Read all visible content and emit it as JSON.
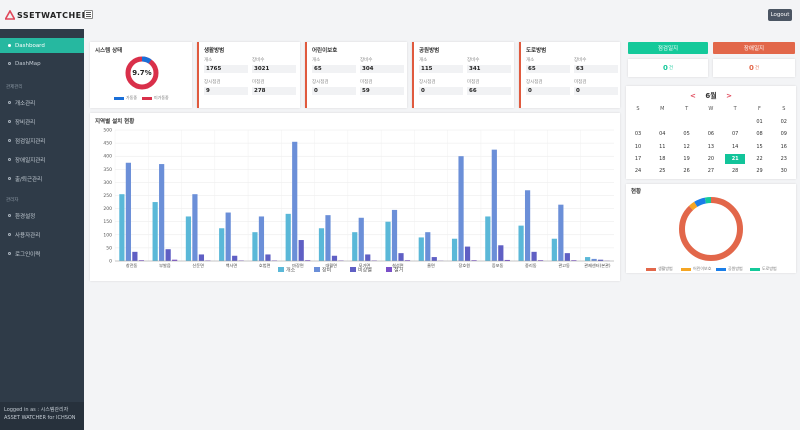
{
  "app": {
    "logo_text": "SSETWATCHER",
    "logout_label": "Logout"
  },
  "sidebar": {
    "items_top": [
      {
        "label": "Dashboard",
        "active": true
      },
      {
        "label": "DashMap",
        "active": false
      }
    ],
    "section_admin": "관제관리",
    "items_admin": [
      {
        "label": "개소관리"
      },
      {
        "label": "장비관리"
      },
      {
        "label": "점검일지관리"
      },
      {
        "label": "장애일지관리"
      },
      {
        "label": "출/퇴근관리"
      }
    ],
    "section_system": "관리자",
    "items_system": [
      {
        "label": "환경설정"
      },
      {
        "label": "사용자관리"
      },
      {
        "label": "로그인이력"
      }
    ],
    "footer_user": "Logged in as : 시스템관리자",
    "footer_product": "ASSET WATCHER for ICHSON"
  },
  "system_status": {
    "title": "시스템 상태",
    "percent_label": "9.7%",
    "percent_value": 9.7,
    "legend": [
      {
        "label": "가동중",
        "color": "#1a6fd8"
      },
      {
        "label": "미가동중",
        "color": "#d9304a"
      }
    ]
  },
  "stat_cards": [
    {
      "title": "생활방범",
      "values": [
        {
          "label": "개소",
          "value": "1765"
        },
        {
          "label": "장비수",
          "value": "3021"
        },
        {
          "label": "장시점검",
          "value": "9"
        },
        {
          "label": "미점검",
          "value": "278"
        }
      ]
    },
    {
      "title": "어린이보호",
      "values": [
        {
          "label": "개소",
          "value": "65"
        },
        {
          "label": "장비수",
          "value": "304"
        },
        {
          "label": "장시점검",
          "value": "0"
        },
        {
          "label": "미점검",
          "value": "59"
        }
      ]
    },
    {
      "title": "공원방범",
      "values": [
        {
          "label": "개소",
          "value": "115"
        },
        {
          "label": "장비수",
          "value": "341"
        },
        {
          "label": "장시점검",
          "value": "0"
        },
        {
          "label": "미점검",
          "value": "66"
        }
      ]
    },
    {
      "title": "도로방범",
      "values": [
        {
          "label": "개소",
          "value": "65"
        },
        {
          "label": "장비수",
          "value": "63"
        },
        {
          "label": "장시점검",
          "value": "0"
        },
        {
          "label": "미점검",
          "value": "0"
        }
      ]
    }
  ],
  "chart": {
    "title": "지역별 설치 현황"
  },
  "chart_data": {
    "type": "bar",
    "title": "지역별 설치 현황",
    "categories": [
      "창전동",
      "부발읍",
      "신둔면",
      "백사면",
      "호법면",
      "마장면",
      "대월면",
      "모가면",
      "설성면",
      "율면",
      "장호원",
      "증포동",
      "중리동",
      "관고동",
      "관제센터(본관)"
    ],
    "ylim": [
      0,
      500
    ],
    "yticks": [
      0,
      50,
      100,
      150,
      200,
      250,
      300,
      350,
      400,
      450,
      500
    ],
    "grid": true,
    "legend_position": "bottom",
    "series": [
      {
        "name": "개소",
        "color": "#5ab8d8",
        "values": [
          255,
          225,
          170,
          125,
          110,
          180,
          125,
          110,
          150,
          90,
          85,
          170,
          135,
          85,
          15
        ]
      },
      {
        "name": "장비",
        "color": "#6b8fd8",
        "values": [
          375,
          370,
          255,
          185,
          170,
          455,
          175,
          165,
          195,
          110,
          400,
          425,
          270,
          215,
          8
        ]
      },
      {
        "name": "비상벨",
        "color": "#5f5fc4",
        "values": [
          35,
          45,
          25,
          20,
          25,
          80,
          20,
          25,
          30,
          15,
          55,
          60,
          35,
          30,
          5
        ]
      },
      {
        "name": "철거",
        "color": "#7a4fc8",
        "values": [
          3,
          5,
          2,
          2,
          2,
          3,
          2,
          2,
          3,
          1,
          3,
          4,
          3,
          3,
          1
        ]
      }
    ]
  },
  "right": {
    "inspection_button": "점검일지",
    "inspection_color": "#14c99a",
    "inspection_count": "0",
    "fault_button": "장애일지",
    "fault_color": "#e2674a",
    "fault_count": "0",
    "count_unit": "건"
  },
  "calendar": {
    "prev": "<",
    "next": ">",
    "month_label": "6월",
    "days_of_week": [
      "S",
      "M",
      "T",
      "W",
      "T",
      "F",
      "S"
    ],
    "weeks": [
      [
        "",
        "",
        "",
        "",
        "",
        "01",
        "02"
      ],
      [
        "03",
        "04",
        "05",
        "06",
        "07",
        "08",
        "09"
      ],
      [
        "10",
        "11",
        "12",
        "13",
        "14",
        "15",
        "16"
      ],
      [
        "17",
        "18",
        "19",
        "20",
        "21",
        "22",
        "23"
      ],
      [
        "24",
        "25",
        "26",
        "27",
        "28",
        "29",
        "30"
      ]
    ],
    "today": "21"
  },
  "donut": {
    "title": "현황",
    "segments": [
      {
        "label": "생활방범",
        "value": 1765,
        "color": "#e2674a"
      },
      {
        "label": "어린이보호",
        "value": 65,
        "color": "#f5a623"
      },
      {
        "label": "공원방범",
        "value": 115,
        "color": "#1a7ee8"
      },
      {
        "label": "도로방범",
        "value": 65,
        "color": "#14c99a"
      }
    ]
  }
}
